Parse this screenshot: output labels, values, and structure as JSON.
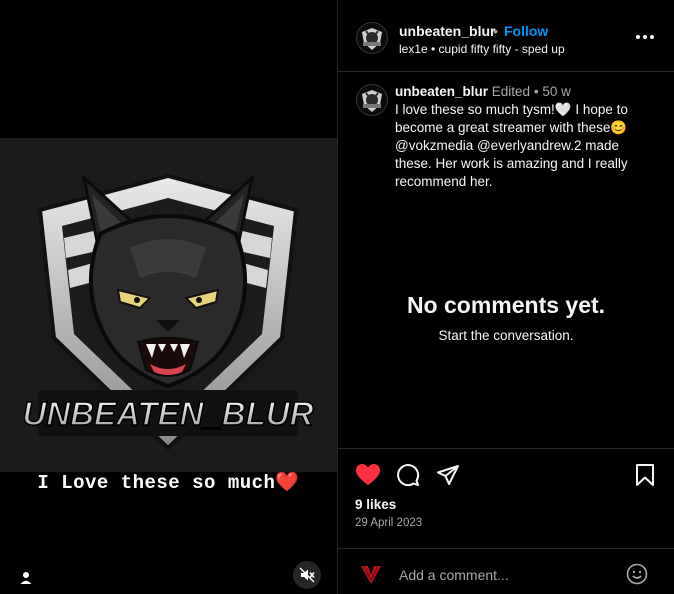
{
  "post": {
    "username": "unbeaten_blur",
    "follow_label": "Follow",
    "separator": "•",
    "audio": "lex1e • cupid fifty fifty - sped up",
    "edited_label": "Edited",
    "age": "50 w",
    "caption": "I love these so much tysm!🤍 I hope to become a great streamer with these😊 @vokzmedia @everlyandrew.2 made these. Her work is amazing and I really recommend her.",
    "overlay_text": "I Love these so much❤️",
    "logo_text": "UNBEATEN_BLUR"
  },
  "comments": {
    "empty_title": "No comments yet.",
    "empty_subtitle": "Start the conversation."
  },
  "stats": {
    "likes": "9 likes",
    "date": "29 April 2023"
  },
  "comment_box": {
    "placeholder": "Add a comment..."
  },
  "icons": {
    "like": "heart-filled-icon",
    "comment": "speech-bubble-icon",
    "share": "paper-plane-icon",
    "save": "bookmark-icon",
    "more": "more-horizontal-icon",
    "mute": "speaker-muted-icon",
    "tagged": "user-icon",
    "emoji": "smiley-icon"
  },
  "colors": {
    "background": "#000000",
    "like": "#ff3040",
    "follow": "#0095f6",
    "divider": "#262626",
    "secondary_text": "#a8a8a8"
  }
}
